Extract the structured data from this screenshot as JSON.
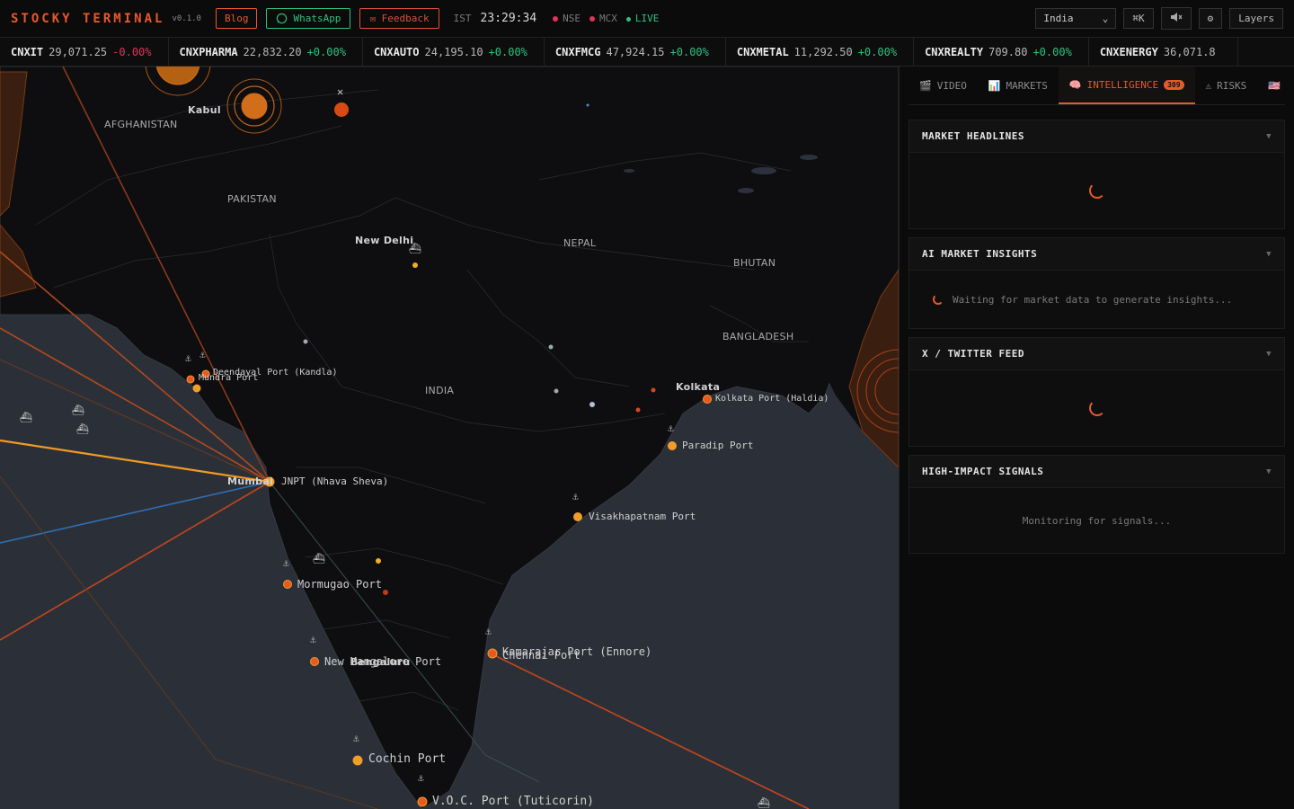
{
  "header": {
    "brand": "STOCKY TERMINAL",
    "version": "v0.1.0",
    "blog_label": "Blog",
    "whatsapp_label": "WhatsApp",
    "feedback_label": "✉ Feedback",
    "tz": "IST",
    "time": "23:29:34",
    "exchanges": [
      "NSE",
      "MCX"
    ],
    "live_label": "LIVE",
    "country": "India",
    "shortcut_label": "⌘K",
    "settings_icon": "⚙",
    "layers_label": "Layers"
  },
  "ticker": [
    {
      "symbol": "CNXIT",
      "price": "29,071.25",
      "change": "-0.00%",
      "dir": "down"
    },
    {
      "symbol": "CNXPHARMA",
      "price": "22,832.20",
      "change": "+0.00%",
      "dir": "up"
    },
    {
      "symbol": "CNXAUTO",
      "price": "24,195.10",
      "change": "+0.00%",
      "dir": "up"
    },
    {
      "symbol": "CNXFMCG",
      "price": "47,924.15",
      "change": "+0.00%",
      "dir": "up"
    },
    {
      "symbol": "CNXMETAL",
      "price": "11,292.50",
      "change": "+0.00%",
      "dir": "up"
    },
    {
      "symbol": "CNXREALTY",
      "price": "709.80",
      "change": "+0.00%",
      "dir": "up"
    },
    {
      "symbol": "CNXENERGY",
      "price": "36,071.8",
      "change": "",
      "dir": "up"
    }
  ],
  "map": {
    "countries": [
      "AFGHANISTAN",
      "PAKISTAN",
      "NEPAL",
      "BHUTAN",
      "BANGLADESH",
      "INDIA"
    ],
    "cities": [
      "Kabul",
      "New Delhi",
      "Kolkata",
      "Mumbai",
      "Bengaluru"
    ],
    "ports": [
      "Deendayal Port (Kandla)",
      "Mundra Port",
      "JNPT (Nhava Sheva)",
      "Mormugao Port",
      "New Mangalore Port",
      "Kamarajar Port (Ennore)",
      "Chennai Port",
      "Cochin Port",
      "V.O.C. Port (Tuticorin)",
      "Visakhapatnam Port",
      "Paradip Port",
      "Kolkata Port (Haldia)"
    ]
  },
  "panel": {
    "tabs": [
      {
        "icon": "🎬",
        "label": "VIDEO"
      },
      {
        "icon": "📊",
        "label": "MARKETS"
      },
      {
        "icon": "🧠",
        "label": "INTELLIGENCE",
        "badge": "309"
      },
      {
        "icon": "⚠",
        "label": "RISKS"
      },
      {
        "icon": "🇺🇸",
        "label": ""
      }
    ],
    "cards": [
      {
        "title": "MARKET HEADLINES",
        "body": ""
      },
      {
        "title": "AI MARKET INSIGHTS",
        "body": "Waiting for market data to generate insights..."
      },
      {
        "title": "X / TWITTER FEED",
        "body": ""
      },
      {
        "title": "HIGH-IMPACT SIGNALS",
        "body": "Monitoring for signals..."
      }
    ]
  }
}
